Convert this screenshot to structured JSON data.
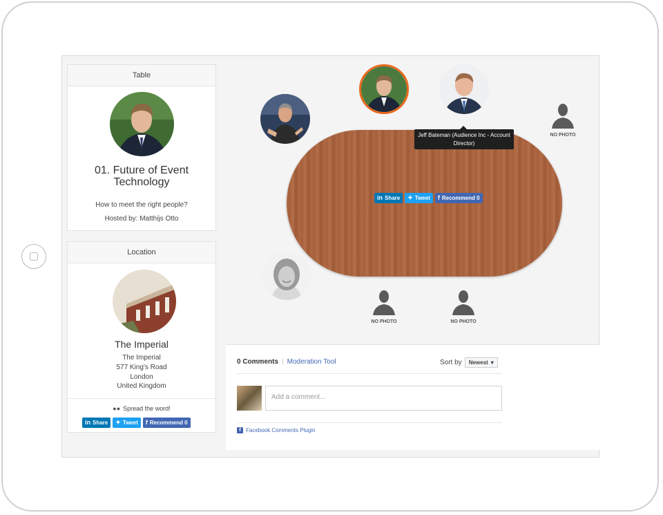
{
  "table_panel": {
    "header": "Table",
    "title": "01. Future of Event Technology",
    "subtitle": "How to meet the right people?",
    "host": "Hosted by: Matthijs Otto"
  },
  "location_panel": {
    "header": "Location",
    "name": "The Imperial",
    "address": [
      "The Imperial",
      "577 King's Road",
      "London",
      "United Kingdom"
    ],
    "spread_label": "Spread the word!"
  },
  "share": {
    "linkedin": "Share",
    "twitter": "Tweet",
    "facebook": "Recommend 0"
  },
  "tooltip": "Jeff Bateman (Audience Inc - Account Director)",
  "seats": {
    "no_photo_label": "NO PHOTO"
  },
  "comments": {
    "count": "0 Comments",
    "moderation": "Moderation Tool",
    "sort_label": "Sort by",
    "sort_value": "Newest",
    "placeholder": "Add a comment...",
    "plugin": "Facebook Comments Plugin"
  },
  "colors": {
    "linkedin": "#0077b5",
    "twitter": "#1da1f2",
    "facebook": "#4267b2",
    "host_ring": "#e8671c",
    "table_wood": "#a7603c"
  }
}
